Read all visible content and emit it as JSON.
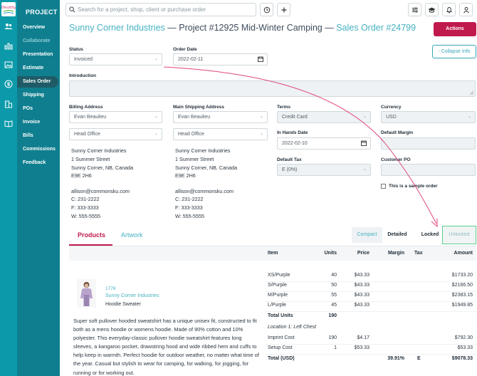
{
  "app": {
    "logo_text": "Healthy"
  },
  "nav": {
    "title": "PROJECT",
    "items": [
      {
        "label": "Overview",
        "dim": false,
        "active": false
      },
      {
        "label": "Collaborate",
        "dim": true,
        "active": false
      },
      {
        "label": "Presentation",
        "dim": false,
        "active": false
      },
      {
        "label": "Estimate",
        "dim": false,
        "active": false
      },
      {
        "label": "Sales Order",
        "dim": false,
        "active": true
      },
      {
        "label": "Shipping",
        "dim": false,
        "active": false
      },
      {
        "label": "POs",
        "dim": false,
        "active": false
      },
      {
        "label": "Invoice",
        "dim": false,
        "active": false
      },
      {
        "label": "Bills",
        "dim": false,
        "active": false
      },
      {
        "label": "Commissions",
        "dim": false,
        "active": false
      },
      {
        "label": "Feedback",
        "dim": false,
        "active": false
      }
    ]
  },
  "search": {
    "placeholder": "Search for a project, shop, client or purchase order"
  },
  "header": {
    "client": "Sunny Corner Industries",
    "project": "— Project #12925 Mid-Winter Camping —",
    "order": "Sales Order #24799",
    "actions_label": "Actions",
    "collapse_label": "- Collapse Info"
  },
  "form": {
    "status_label": "Status",
    "status_value": "Invoiced",
    "order_date_label": "Order Date",
    "order_date_value": "2022-02-11",
    "intro_label": "Introduction",
    "billing_label": "Billing Address",
    "billing_contact": "Evan Beaulieu",
    "billing_location": "Head Office",
    "shipping_label": "Main Shipping Address",
    "shipping_contact": "Evan Beaulieu",
    "shipping_location": "Head Office",
    "billing_lines": [
      "Sunny Corner Industries",
      "1 Summer Street",
      "Sunny Corner, NB, Canada",
      "E9E 2H6",
      "",
      "allison@commonsku.com",
      "C: 231-2222",
      "F: 333-3333",
      "W: 555-5555"
    ],
    "shipping_lines": [
      "Sunny Corner Industries",
      "1 Summer Street",
      "Sunny Corner, NB, Canada",
      "E9E 2H6",
      "",
      "allison@commonsku.com",
      "C: 231-2222",
      "F: 333-3333",
      "W: 555-5555"
    ],
    "terms_label": "Terms",
    "terms_value": "Credit Card",
    "currency_label": "Currency",
    "currency_value": "USD",
    "in_hands_label": "In Hands Date",
    "in_hands_value": "2022-02-10",
    "default_margin_label": "Default Margin",
    "default_tax_label": "Default Tax",
    "default_tax_value": "E (0%)",
    "customer_po_label": "Customer PO",
    "sample_label": "This is a sample order"
  },
  "tabs": {
    "products": "Products",
    "artwork": "Artwork"
  },
  "view": {
    "compact": "Compact",
    "detailed": "Detailed",
    "locked": "Locked",
    "unlocked": "Unlocked"
  },
  "table": {
    "headers": {
      "item": "Item",
      "units": "Units",
      "price": "Price",
      "margin": "Margin",
      "tax": "Tax",
      "amount": "Amount"
    },
    "product": {
      "sku": "1776",
      "supplier": "Sunny Corner Industries",
      "name": "Hoodie Sweater",
      "description": "Super soft pullover hooded sweatshirt has a unique unisex fit, constructed to fit both as a mens hoodie or womens hoodie. Made of 90% cotton and 10% polyester. This everyday-classic pullover hoodie sweatshirt features long sleeves, a kangaroo pocket, drawstring hood and wide ribbed hem and cuffs to help keep in warmth. Perfect hoodie for outdoor weather, no matter what time of the year. Casual but stylish to wear for camping, for walking, for jogging, for running or for working out."
    },
    "rows": [
      {
        "item": "XS/Purple",
        "units": "40",
        "price": "$43.33",
        "margin": "",
        "tax": "",
        "amount": "$1733.20",
        "style": ""
      },
      {
        "item": "S/Purple",
        "units": "50",
        "price": "$43.33",
        "margin": "",
        "tax": "",
        "amount": "$2166.50",
        "style": ""
      },
      {
        "item": "M/Purple",
        "units": "55",
        "price": "$43.33",
        "margin": "",
        "tax": "",
        "amount": "$2383.15",
        "style": ""
      },
      {
        "item": "L/Purple",
        "units": "45",
        "price": "$43.33",
        "margin": "",
        "tax": "",
        "amount": "$1949.85",
        "style": ""
      },
      {
        "item": "Total Units",
        "units": "190",
        "price": "",
        "margin": "",
        "tax": "",
        "amount": "",
        "style": "b"
      },
      {
        "item": "Location 1: Left Chest",
        "units": "",
        "price": "",
        "margin": "",
        "tax": "",
        "amount": "",
        "style": "i"
      },
      {
        "item": "Imprint Cost",
        "units": "190",
        "price": "$4.17",
        "margin": "",
        "tax": "",
        "amount": "$792.30",
        "style": ""
      },
      {
        "item": "Setup Cost",
        "units": "1",
        "price": "$53.33",
        "margin": "",
        "tax": "",
        "amount": "$53.33",
        "style": ""
      },
      {
        "item": "Total (USD)",
        "units": "",
        "price": "",
        "margin": "39.91%",
        "tax": "E",
        "amount": "$9078.33",
        "style": "b"
      }
    ]
  },
  "colors": {
    "brand": "#0c9aaa",
    "accent": "#c01a4d",
    "link": "#46b2c2",
    "annotation": "#e0457a"
  }
}
